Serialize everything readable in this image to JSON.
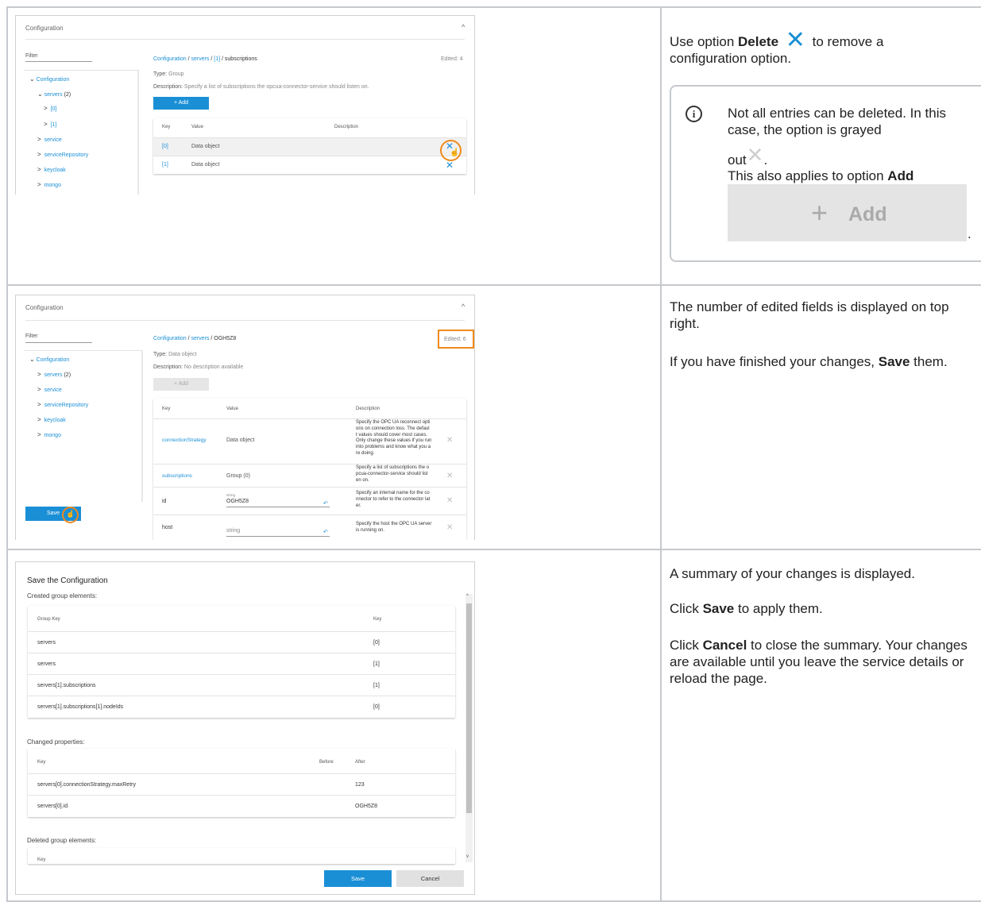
{
  "colors": {
    "accent": "#1a8fd6",
    "highlight": "#f08a1c",
    "info_border": "#c6c9cd"
  },
  "row1": {
    "panel_title": "Configuration",
    "filter_label": "Filter",
    "breadcrumb": {
      "a": "Configuration",
      "sep1": " / ",
      "b": "servers",
      "sep2": " / ",
      "c": "[1]",
      "rest": " / subscriptions"
    },
    "edited": "Edited: 4",
    "tree": {
      "root": "Configuration",
      "servers": "servers",
      "servers_count": "(2)",
      "s0": "[0]",
      "s1": "[1]",
      "service": "service",
      "serviceRepository": "serviceRepository",
      "keycloak": "keycloak",
      "mongo": "mongo"
    },
    "type_label": "Type: ",
    "type_value": "Group",
    "desc_label": "Description: ",
    "desc_value": "Specify a list of subscriptions the opcua-connector-service should listen on.",
    "add_label": "+ Add",
    "cols": {
      "key": "Key",
      "value": "Value",
      "description": "Description"
    },
    "rows": [
      {
        "key": "[0]",
        "value": "Data object"
      },
      {
        "key": "[1]",
        "value": "Data object"
      }
    ],
    "instruction_pre": "Use option ",
    "instruction_bold": "Delete",
    "instruction_post": " to remove a configuration option.",
    "info_line1": "Not all entries can be deleted. In this case, the option is grayed",
    "info_out": "out",
    "info_line2_pre": "This also applies to option ",
    "info_line2_bold": "Add",
    "info_add_label": "Add",
    "info_period": "."
  },
  "row2": {
    "panel_title": "Configuration",
    "filter_label": "Filter",
    "breadcrumb": {
      "a": "Configuration",
      "sep1": " / ",
      "b": "servers",
      "rest": " / OGH5Z8"
    },
    "edited": "Edited: 6",
    "tree": {
      "root": "Configuration",
      "servers": "servers",
      "servers_count": "(2)",
      "service": "service",
      "serviceRepository": "serviceRepository",
      "keycloak": "keycloak",
      "mongo": "mongo"
    },
    "type_label": "Type: ",
    "type_value": "Data object",
    "desc_label": "Description: ",
    "desc_value": "No description available",
    "add_label": "+ Add",
    "cols": {
      "key": "Key",
      "value": "Value",
      "description": "Description"
    },
    "rows": [
      {
        "key": "connectionStrategy",
        "value": "Data object",
        "desc": [
          "Specify the OPC UA reconnect opti",
          "ons on connection loss. The defaul",
          "t values should cover most cases.",
          "Only change these values if you run",
          "into problems and know what you a",
          "re doing."
        ]
      },
      {
        "key": "subscriptions",
        "value": "Group (0)",
        "desc": [
          "Specify a list of subscriptions the o",
          "pcua-connector-service should list",
          "en on."
        ]
      },
      {
        "key": "id",
        "value_type": "string",
        "value": "OGH5Z8",
        "desc": [
          "Specify an internal name for the co",
          "nnector to refer to the connector lat",
          "er."
        ]
      },
      {
        "key": "host",
        "value": "string",
        "desc": [
          "Specify the host the OPC UA server",
          "is running on."
        ]
      }
    ],
    "save_label": "Save",
    "text1": "The number of edited fields is displayed on top right.",
    "text2_pre": "If you have finished your changes, ",
    "text2_bold": "Save",
    "text2_post": " them."
  },
  "row3": {
    "dialog_title": "Save the Configuration",
    "created_label": "Created group elements:",
    "created_cols": {
      "group_key": "Group Key",
      "key": "Key"
    },
    "created_rows": [
      {
        "group_key": "servers",
        "key": "[0]"
      },
      {
        "group_key": "servers",
        "key": "[1]"
      },
      {
        "group_key": "servers[1].subscriptions",
        "key": "[1]"
      },
      {
        "group_key": "servers[1].subscriptions[1].nodeIds",
        "key": "[0]"
      }
    ],
    "changed_label": "Changed properties:",
    "changed_cols": {
      "key": "Key",
      "before": "Before",
      "after": "After"
    },
    "changed_rows": [
      {
        "key": "servers[0].connectionStrategy.maxRetry",
        "before": "",
        "after": "123"
      },
      {
        "key": "servers[0].id",
        "before": "",
        "after": "OGH5Z8"
      }
    ],
    "deleted_label": "Deleted group elements:",
    "deleted_col": "Key",
    "save_label": "Save",
    "cancel_label": "Cancel",
    "text1": "A summary of your changes is displayed.",
    "text2_pre": "Click ",
    "text2_bold": "Save",
    "text2_post": " to apply them.",
    "text3_pre": "Click ",
    "text3_bold": "Cancel",
    "text3_post": " to close the summary. Your changes are available until you leave the service details or reload the page."
  }
}
